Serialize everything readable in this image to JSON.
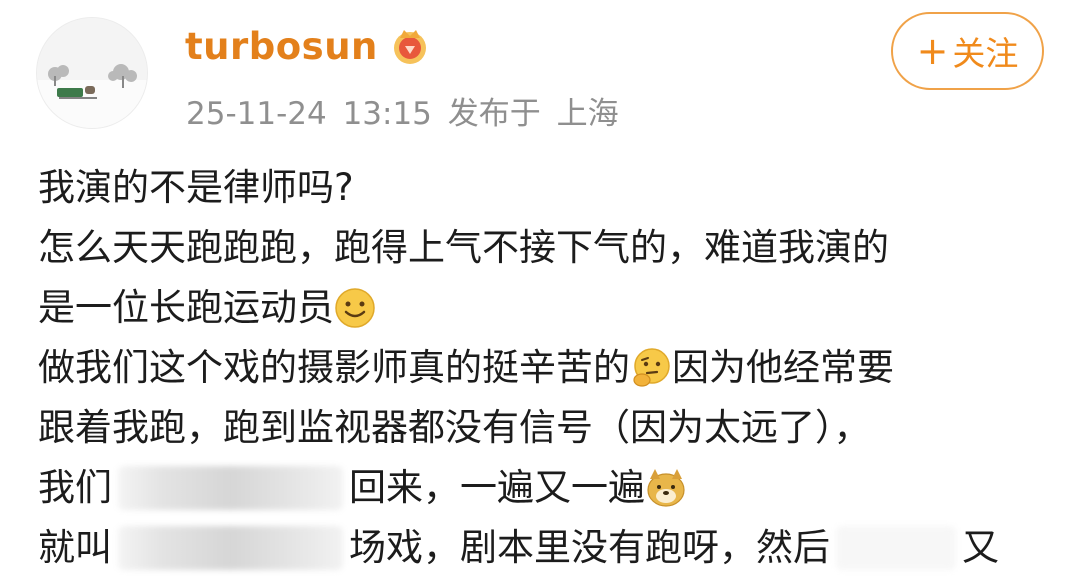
{
  "header": {
    "username": "turbosun",
    "vip_badge_icon": "crown-badge-icon",
    "timestamp": "25-11-24 13:15",
    "location_prefix": "发布于",
    "location": "上海",
    "follow_label": "关注",
    "follow_icon": "plus-icon",
    "accent_color": "#e3801b"
  },
  "post": {
    "line1": "我演的不是律师吗?",
    "line2": "怎么天天跑跑跑，跑得上气不接下气的，难道我演的",
    "line3": "是一位长跑运动员",
    "line3_emoji": "smile-emoji-icon",
    "line4_a": "做我们这个戏的摄影师真的挺辛苦的",
    "line4_emoji": "thinking-emoji-icon",
    "line4_b": "因为他经常要",
    "line5": "跟着我跑，跑到监视器都没有信号（因为太远了），",
    "line6_a": "我们",
    "line6_b": "回来，一遍又一遍",
    "line6_emoji": "doge-emoji-icon",
    "line7_a": "就叫",
    "line7_b": "场戏，剧本里没有跑呀，然后",
    "line7_c": "又"
  }
}
